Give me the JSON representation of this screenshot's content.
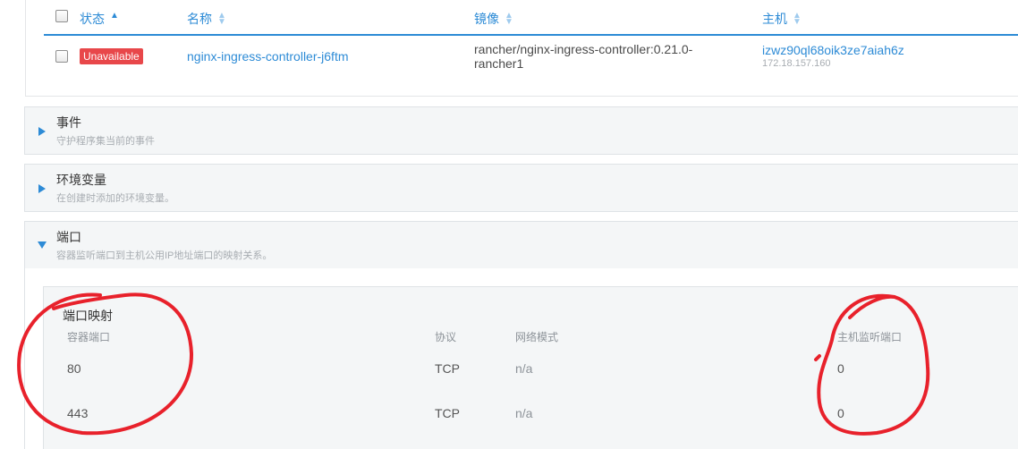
{
  "pods_table": {
    "headers": {
      "status": "状态",
      "name": "名称",
      "image": "镜像",
      "host": "主机"
    },
    "rows": [
      {
        "status": "Unavailable",
        "status_color": "#e8474a",
        "name": "nginx-ingress-controller-j6ftm",
        "image_line1": "rancher/nginx-ingress-controller:0.21.0-",
        "image_line2": "rancher1",
        "host": "izwz90ql68oik3ze7aiah6z",
        "host_ip": "172.18.157.160"
      }
    ]
  },
  "sections": {
    "events": {
      "title": "事件",
      "description": "守护程序集当前的事件",
      "expanded": false
    },
    "env": {
      "title": "环境变量",
      "description": "在创建时添加的环境变量。",
      "expanded": false
    },
    "ports": {
      "title": "端口",
      "description": "容器监听端口到主机公用IP地址端口的映射关系。",
      "expanded": true
    }
  },
  "port_mapping": {
    "title": "端口映射",
    "headers": {
      "container_port": "容器端口",
      "protocol": "协议",
      "network_mode": "网络模式",
      "host_port": "主机监听端口"
    },
    "rows": [
      {
        "container_port": "80",
        "protocol": "TCP",
        "network_mode": "n/a",
        "host_port": "0"
      },
      {
        "container_port": "443",
        "protocol": "TCP",
        "network_mode": "n/a",
        "host_port": "0"
      }
    ]
  },
  "colors": {
    "accent": "#2d8bd6",
    "annotation": "#e8212b",
    "panel": "#f4f6f7"
  }
}
